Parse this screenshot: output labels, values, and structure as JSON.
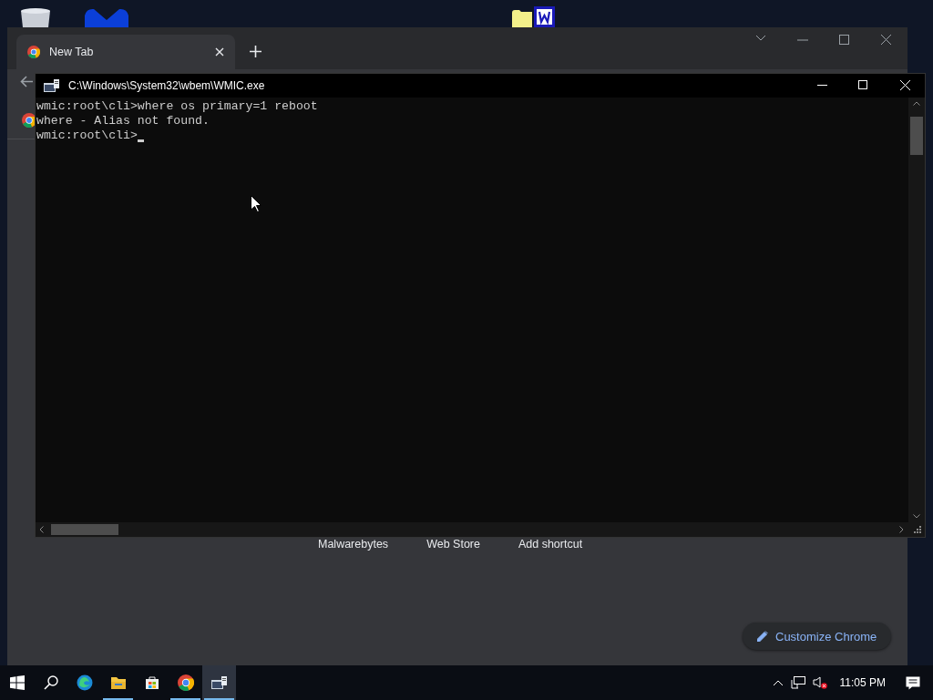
{
  "browser": {
    "tabs": [
      {
        "title": "New Tab",
        "selected": true
      }
    ],
    "shortcuts": [
      "Malwarebytes",
      "Web Store",
      "Add shortcut"
    ],
    "customize_button": "Customize Chrome"
  },
  "console": {
    "title": "C:\\Windows\\System32\\wbem\\WMIC.exe",
    "lines": [
      "wmic:root\\cli>where os primary=1 reboot",
      "where - Alias not found.",
      "wmic:root\\cli>"
    ]
  },
  "taskbar": {
    "apps": [
      {
        "kind": "edge",
        "running": false,
        "selected": false
      },
      {
        "kind": "explorer",
        "running": true,
        "selected": false
      },
      {
        "kind": "store",
        "running": false,
        "selected": false
      },
      {
        "kind": "chrome",
        "running": true,
        "selected": false
      },
      {
        "kind": "console",
        "running": true,
        "selected": true
      }
    ],
    "clock": "11:05 PM"
  }
}
